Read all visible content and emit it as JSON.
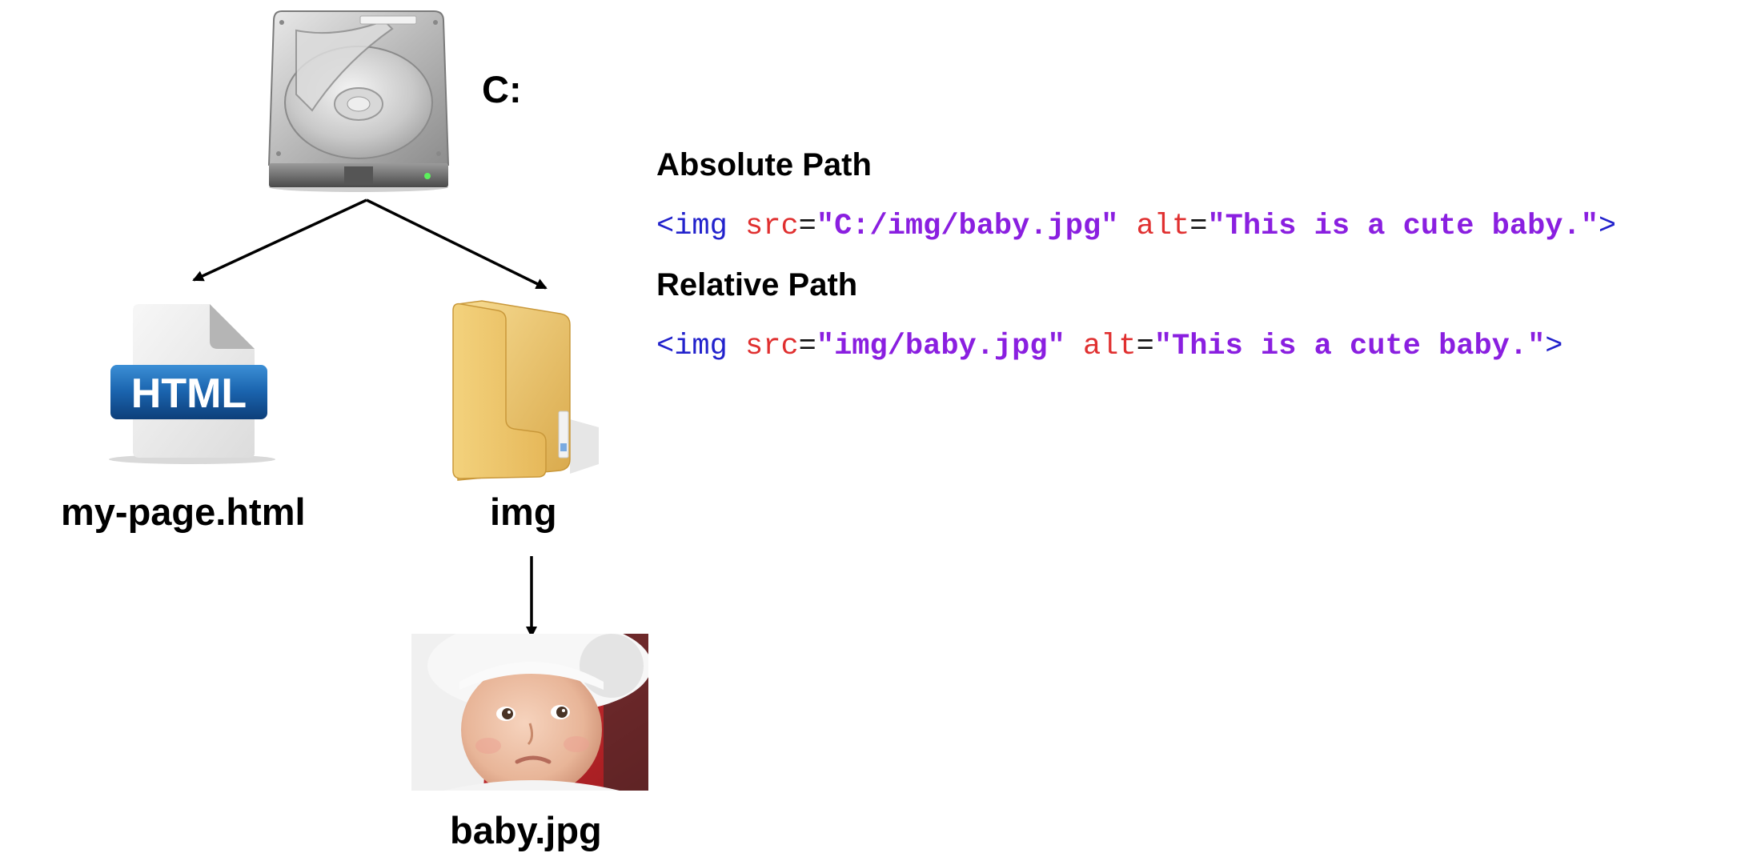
{
  "diagram": {
    "drive": {
      "label": "C:"
    },
    "html_file": {
      "label": "my-page.html",
      "badge": "HTML"
    },
    "folder": {
      "label": "img"
    },
    "image_file": {
      "label": "baby.jpg"
    }
  },
  "paths": {
    "absolute": {
      "heading": "Absolute Path",
      "tag_open": "<img",
      "attr1": "src",
      "eq1": "=",
      "val1": "\"C:/img/baby.jpg\"",
      "attr2": "alt",
      "eq2": "=",
      "val2": "\"This is a cute baby.\"",
      "tag_close": ">"
    },
    "relative": {
      "heading": "Relative Path",
      "tag_open": "<img",
      "attr1": "src",
      "eq1": "=",
      "val1": "\"img/baby.jpg\"",
      "attr2": "alt",
      "eq2": "=",
      "val2": "\"This is a cute baby.\"",
      "tag_close": ">"
    }
  },
  "colors": {
    "tag": "#2222cc",
    "attribute": "#e03030",
    "value": "#8a1fe0"
  }
}
